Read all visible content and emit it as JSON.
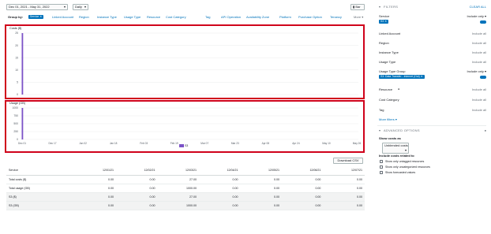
{
  "toolbar": {
    "date_range": "Dec 01, 2021 - May 31, 2022",
    "granularity": "Daily",
    "chart_style": "Bar"
  },
  "group_by": {
    "label": "Group by:",
    "active_chip": "Service",
    "options": [
      "Linked Account",
      "Region",
      "Instance Type",
      "Usage Type",
      "Resource",
      "Cost Category",
      "Tag",
      "API Operation",
      "Availability Zone",
      "Platform",
      "Purchase Option",
      "Tenancy"
    ],
    "more": "More"
  },
  "colors": {
    "accent": "#0073bb",
    "bar": "#7b52c7",
    "highlight": "#d0021b"
  },
  "chart_data": [
    {
      "type": "bar",
      "ylabel": "Costs ($)",
      "yticks": [
        "25",
        "20",
        "15",
        "10",
        "5",
        "0"
      ],
      "ylim": [
        0,
        25
      ],
      "series": [
        {
          "name": "S3",
          "values": [
            27
          ]
        }
      ],
      "categories": [
        "Dec 01"
      ]
    },
    {
      "type": "bar",
      "ylabel": "Usage (GB)",
      "yticks": [
        "1000",
        "750",
        "500",
        "250",
        "0"
      ],
      "ylim": [
        0,
        1000
      ],
      "xticks": [
        "Dec 01",
        "Dec 17",
        "Jan 02",
        "Jan 18",
        "Feb 03",
        "Feb 19",
        "Mar 07",
        "Mar 23",
        "Apr 08",
        "Apr 24",
        "May 10",
        "May 26"
      ],
      "series": [
        {
          "name": "S3",
          "values": [
            1000
          ]
        }
      ],
      "categories": [
        "Dec 01"
      ]
    }
  ],
  "legend": {
    "label": "S3"
  },
  "download_button": "Download CSV",
  "table": {
    "headers": [
      "Service",
      "12/01/21",
      "12/02/21",
      "12/03/21",
      "12/04/21",
      "12/05/21",
      "12/06/21",
      "12/07/21"
    ],
    "rows": [
      [
        "Total costs ($)",
        "0.00",
        "0.00",
        "27.00",
        "0.00",
        "0.00",
        "0.00",
        "0.00"
      ],
      [
        "Total usage (GB)",
        "0.00",
        "0.00",
        "1000.00",
        "0.00",
        "0.00",
        "0.00",
        "0.00"
      ],
      [
        "S3 ($)",
        "0.00",
        "0.00",
        "27.00",
        "0.00",
        "0.00",
        "0.00",
        "0.00"
      ],
      [
        "S3 (GB)",
        "0.00",
        "0.00",
        "1000.00",
        "0.00",
        "0.00",
        "0.00",
        "0.00"
      ]
    ]
  },
  "filters": {
    "title": "FILTERS",
    "clear_all": "CLEAR ALL",
    "service": {
      "label": "Service",
      "mode": "Include only",
      "chip": "S3"
    },
    "fields": [
      {
        "label": "Linked Account",
        "mode": "Include all"
      },
      {
        "label": "Region",
        "mode": "Include all"
      },
      {
        "label": "Instance Type",
        "mode": "Include all"
      },
      {
        "label": "Usage Type",
        "mode": "Include all"
      }
    ],
    "usage_type_group": {
      "label": "Usage Type Group",
      "mode": "Include only",
      "chip": "S3: Data Transfer - Internet (Out)"
    },
    "fields2": [
      {
        "label": "Resource",
        "mode": "Include all"
      },
      {
        "label": "Cost Category",
        "mode": "Include all"
      },
      {
        "label": "Tag",
        "mode": "Include all"
      }
    ],
    "more_filters": "More filters"
  },
  "advanced": {
    "title": "ADVANCED OPTIONS",
    "show_costs_as": "Show costs as",
    "cost_mode": "Unblended costs",
    "include_label": "Include costs related to",
    "checkboxes": [
      "Show only untagged resources",
      "Show only uncategorized resources",
      "Show forecasted values"
    ]
  }
}
